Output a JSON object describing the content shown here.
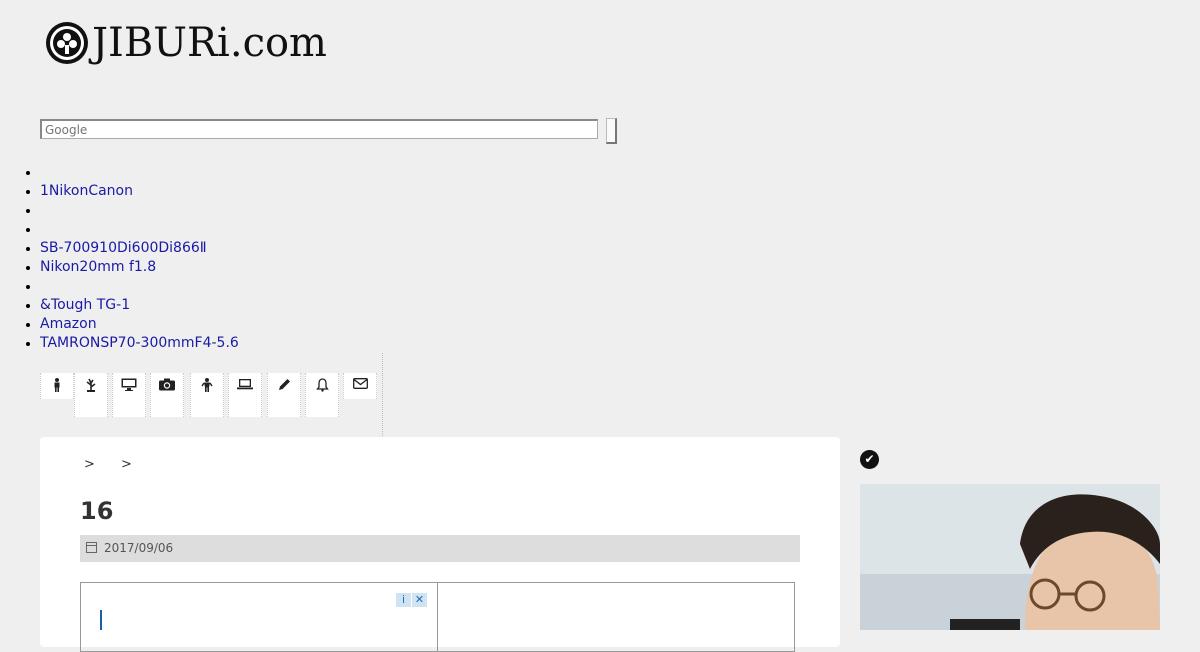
{
  "site": {
    "logo_text": "JIBURi.com"
  },
  "search": {
    "placeholder": "Google"
  },
  "links": [
    "",
    "1NikonCanon",
    "",
    "",
    "SB-700910Di600Di866Ⅱ",
    "Nikon20mm f1.8",
    "",
    "&Tough TG-1",
    "Amazon",
    "TAMRONSP70-300mmF4-5.6"
  ],
  "icon_nav": [
    {
      "icon": "person-icon",
      "glyph": "🚹"
    },
    {
      "icon": "plant-icon",
      "glyph": "⚘"
    },
    {
      "icon": "monitor-icon",
      "glyph": "🖥"
    },
    {
      "icon": "camera-icon",
      "glyph": "📷"
    },
    {
      "icon": "child-icon",
      "glyph": "🚸"
    },
    {
      "icon": "laptop-icon",
      "glyph": "💻"
    },
    {
      "icon": "pencil-icon",
      "glyph": "✎"
    },
    {
      "icon": "bell-icon",
      "glyph": "🔔"
    },
    {
      "icon": "envelope-icon",
      "glyph": "✉"
    }
  ],
  "article": {
    "breadcrumb": [
      ">",
      ">"
    ],
    "title": "16",
    "date": "2017/09/06"
  },
  "sidebar": {
    "check_icon": "check-circle-icon"
  }
}
